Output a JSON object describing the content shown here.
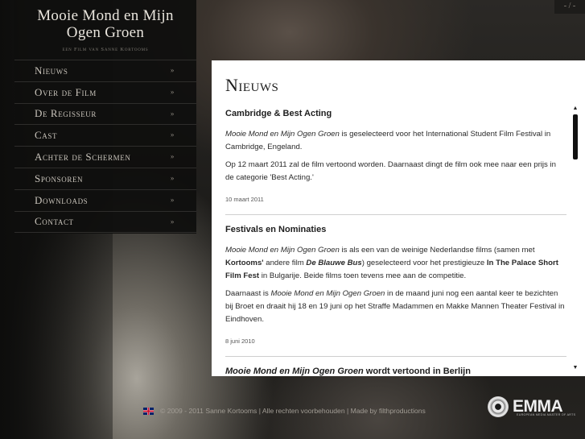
{
  "site": {
    "title": "Mooie Mond en Mijn Ogen Groen",
    "subtitle": "een Film van Sanne Kortooms",
    "lang_switch": "- / -"
  },
  "menu": {
    "items": [
      {
        "label": "Nieuws",
        "arrow": "»"
      },
      {
        "label": "Over de Film",
        "arrow": "»"
      },
      {
        "label": "De Regisseur",
        "arrow": "»"
      },
      {
        "label": "Cast",
        "arrow": "»"
      },
      {
        "label": "Achter de Schermen",
        "arrow": "»"
      },
      {
        "label": "Sponsoren",
        "arrow": "»"
      },
      {
        "label": "Downloads",
        "arrow": "»"
      },
      {
        "label": "Contact",
        "arrow": "»"
      }
    ]
  },
  "content": {
    "heading": "Nieuws",
    "articles": [
      {
        "title": "Cambridge & Best Acting",
        "p1": {
          "film": "Mooie Mond en Mijn Ogen Groen",
          "text": " is geselecteerd voor het International Student Film Festival in Cambridge, Engeland."
        },
        "p2": "Op 12 maart 2011 zal de film vertoond worden. Daarnaast dingt de film ook mee naar een prijs in de categorie 'Best Acting.'",
        "date": "10 maart 2011"
      },
      {
        "title": "Festivals en Nominaties",
        "p1": {
          "film": "Mooie Mond en Mijn Ogen Groen",
          "a": " is als een van de weinige Nederlandse films (samen met ",
          "kortooms": "Kortooms'",
          "b": " andere film ",
          "bus": "De Blauwe Bus",
          "c": ") geselecteerd voor het prestigieuze ",
          "festival": "In The Palace Short Film Fest",
          "d": " in Bulgarije. Beide films toen tevens mee aan de competitie."
        },
        "p2": {
          "a": "Daarnaast is ",
          "film": "Mooie Mond en Mijn Ogen Groen",
          "b": " in de maand juni nog een aantal keer te bezichten bij Broet en draait hij 18 en 19 juni op het Straffe Madammen en Makke Mannen Theater Festival in Eindhoven."
        },
        "date": "8 juni 2010"
      },
      {
        "title_film": "Mooie Mond en Mijn Ogen Groen",
        "title_rest": " wordt vertoond in Berlijn"
      }
    ]
  },
  "scrollbar": {
    "up": "▲",
    "down": "▼"
  },
  "footer": {
    "text": "© 2009 - 2011 Sanne Kortooms | Alle rechten voorbehouden | Made by filthproductions"
  },
  "partner": {
    "name": "EMMA",
    "tagline": "EUROPEAN MEDIA MASTER OF ARTS"
  },
  "colors": {
    "sidebar_bg": "#0f0f0e",
    "menu_text": "#c9c4bb",
    "content_bg": "#ffffff"
  }
}
